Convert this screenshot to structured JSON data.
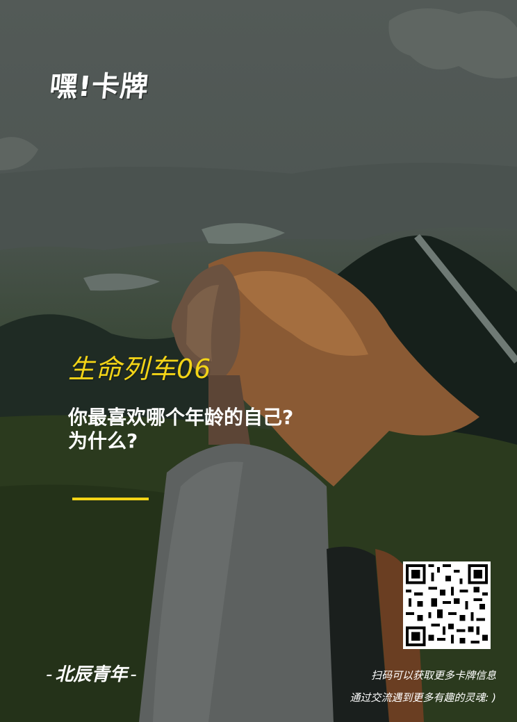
{
  "logo": {
    "text": "嘿!卡牌"
  },
  "series_title": "生命列车06",
  "question": {
    "line1": "你最喜欢哪个年龄的自己?",
    "line2": "为什么?"
  },
  "brand": {
    "dash_left": "-",
    "name": "北辰青年",
    "dash_right": "-"
  },
  "info": {
    "line1": "扫码可以获取更多卡牌信息",
    "line2": "通过交流遇到更多有趣的灵魂: )"
  },
  "qr_icon": "qr-code-icon",
  "colors": {
    "accent": "#f3d417",
    "text": "#ffffff"
  }
}
